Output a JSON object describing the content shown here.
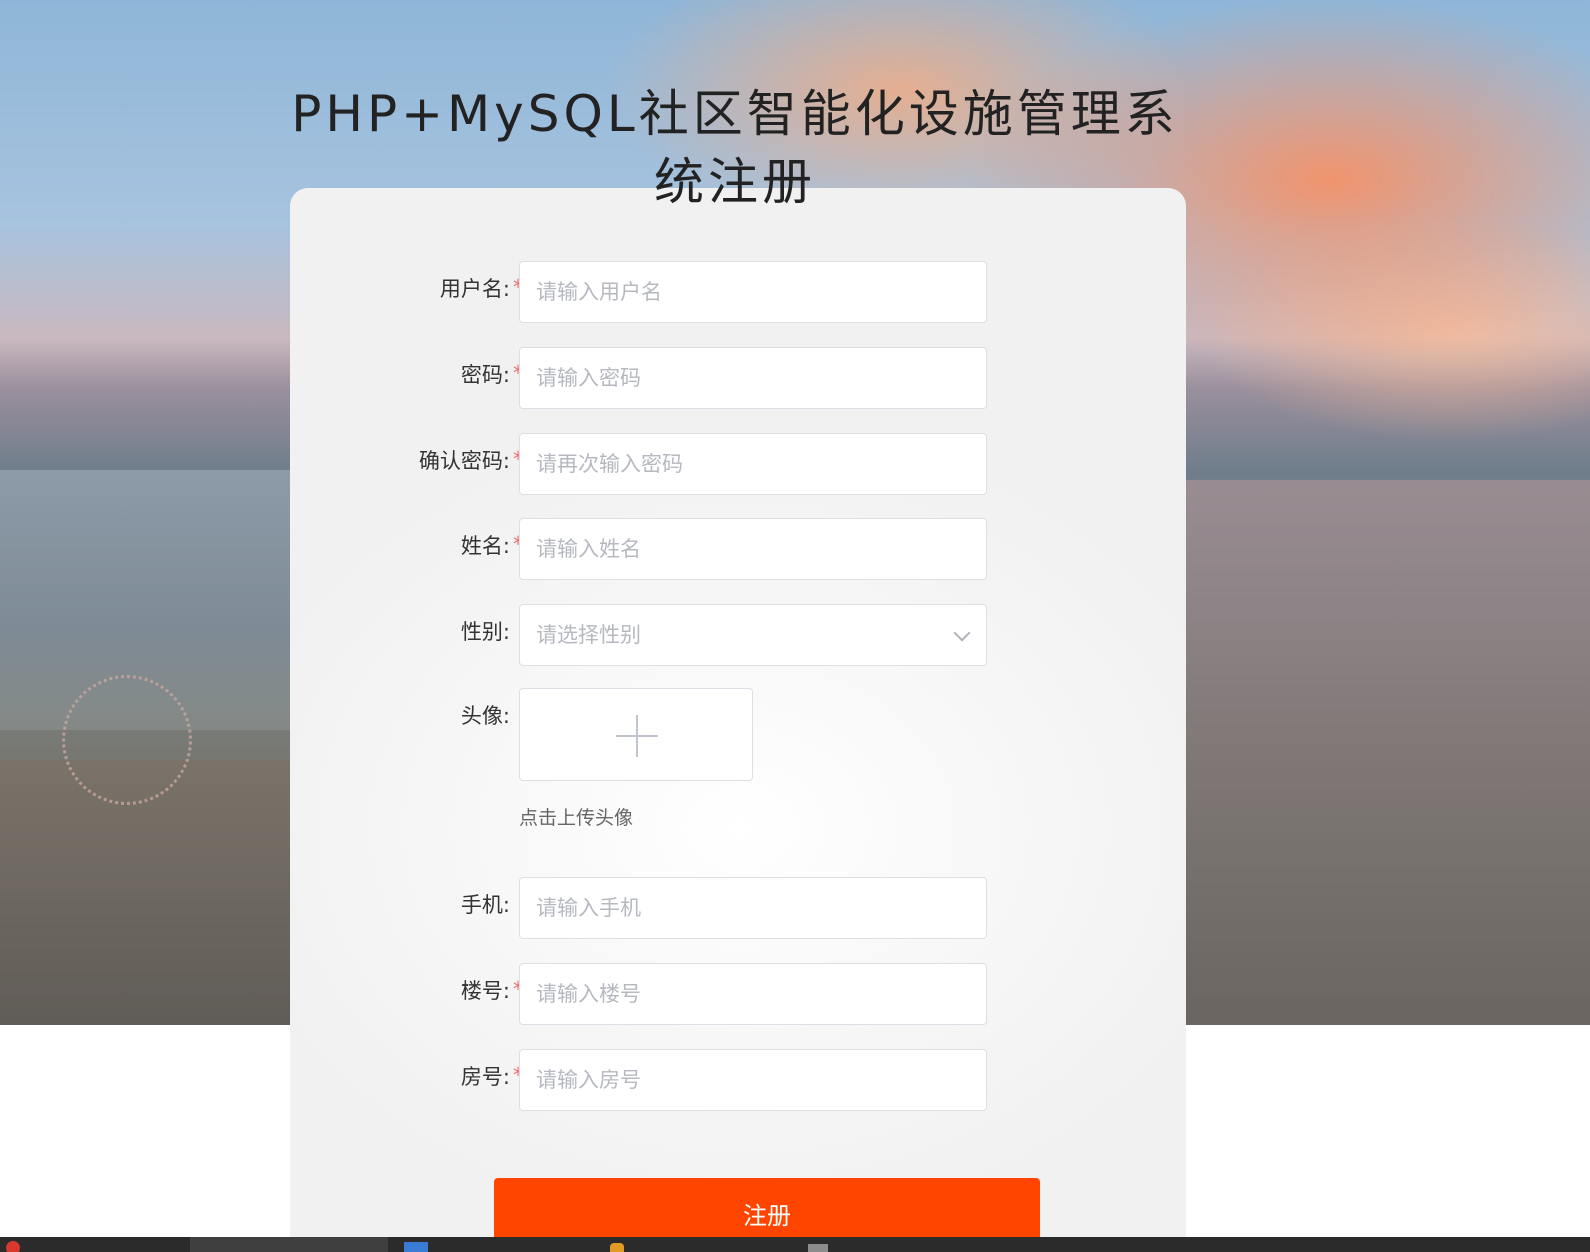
{
  "page": {
    "title": "PHP+MySQL社区智能化设施管理系统注册"
  },
  "form": {
    "username": {
      "label": "用户名:",
      "required": true,
      "placeholder": "请输入用户名"
    },
    "password": {
      "label": "密码:",
      "required": true,
      "placeholder": "请输入密码"
    },
    "confirm_password": {
      "label": "确认密码:",
      "required": true,
      "placeholder": "请再次输入密码"
    },
    "name": {
      "label": "姓名:",
      "required": true,
      "placeholder": "请输入姓名"
    },
    "gender": {
      "label": "性别:",
      "required": false,
      "placeholder": "请选择性别"
    },
    "avatar": {
      "label": "头像:",
      "required": false,
      "hint": "点击上传头像"
    },
    "phone": {
      "label": "手机:",
      "required": false,
      "placeholder": "请输入手机"
    },
    "building": {
      "label": "楼号:",
      "required": true,
      "placeholder": "请输入楼号"
    },
    "room": {
      "label": "房号:",
      "required": true,
      "placeholder": "请输入房号"
    },
    "required_mark": "*",
    "submit_label": "注册"
  },
  "colors": {
    "accent": "#ff4500",
    "required": "#f56c6c"
  },
  "icons": {
    "gender_select": "chevron-down-icon",
    "avatar_upload": "plus-icon"
  }
}
